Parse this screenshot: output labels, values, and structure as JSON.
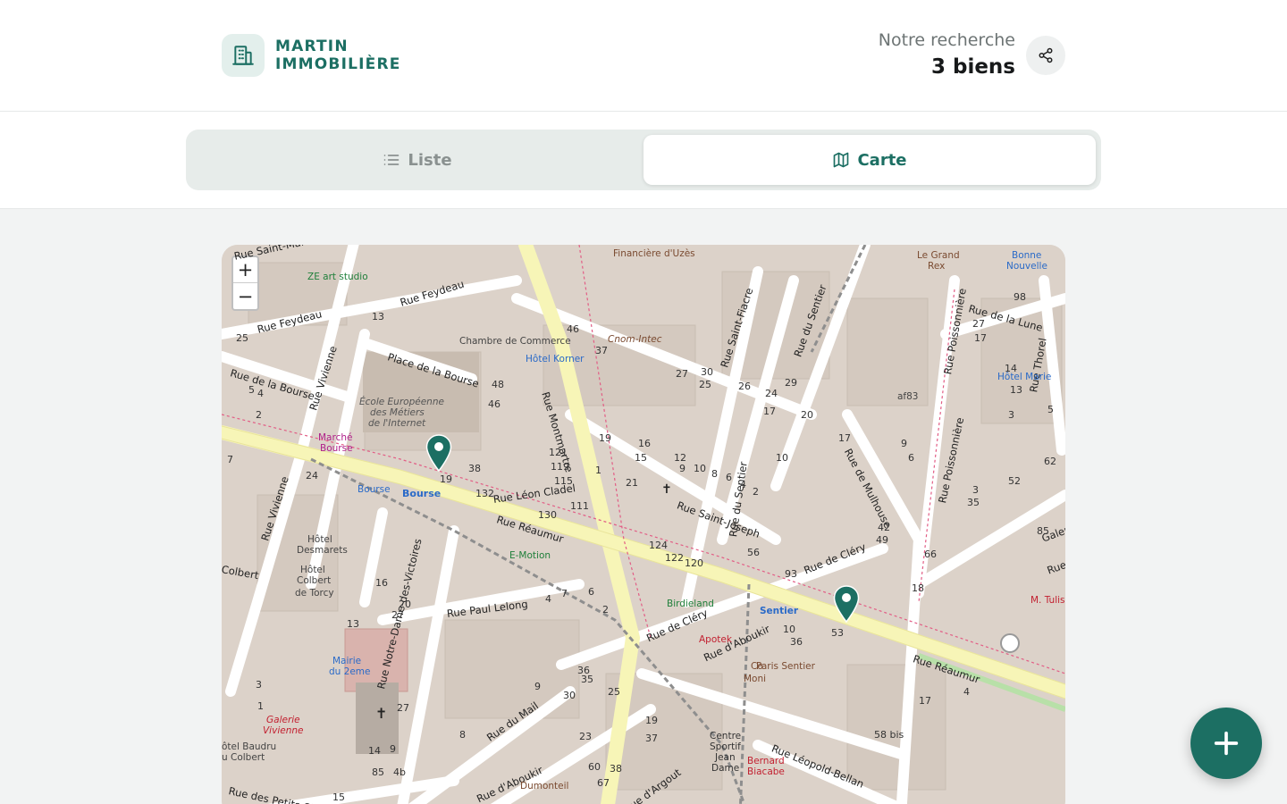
{
  "brand": {
    "line1": "MARTIN",
    "line2": "IMMOBILIÈRE",
    "accent": "#1c6f63"
  },
  "search": {
    "label": "Notre recherche",
    "count": "3 biens"
  },
  "tabs": [
    {
      "label": "Liste",
      "icon": "list-icon",
      "active": false
    },
    {
      "label": "Carte",
      "icon": "map-icon",
      "active": true
    }
  ],
  "map": {
    "zoom_in": "+",
    "zoom_out": "−",
    "streets": {
      "saint_marc": "Rue Saint-Marc",
      "feydeau_1": "Rue Feydeau",
      "feydeau_2": "Rue Feydeau",
      "bourse_1": "Rue de la Bourse",
      "bourse_place": "Place de la Bourse",
      "vivienne_1": "Rue Vivienne",
      "vivienne_2": "Rue Vivienne",
      "montmartre": "Rue Montmartre",
      "reaumur_1": "Rue Réaumur",
      "reaumur_2": "Rue Réaumur",
      "leon_cladel": "Rue Léon Cladel",
      "saint_joseph": "Rue Saint-Joseph",
      "sentier_1": "Rue du Sentier",
      "sentier_2": "Rue du Sentier",
      "saint_fiacre": "Rue Saint-Fiacre",
      "mulhouse": "Rue de Mulhouse",
      "poissonniere_1": "Rue Poissonnière",
      "poissonniere_2": "Rue Poissonnière",
      "lune": "Rue de la Lune",
      "thorel": "Rue Thorel",
      "clery_1": "Rue de Cléry",
      "clery_2": "Rue de Cléry",
      "paul_lelong": "Rue Paul Lelong",
      "notre_dame": "Rue Notre-Dame-des-Victoires",
      "du_mail": "Rue du Mail",
      "aboukir_1": "Rue d'Aboukir",
      "aboukir_2": "Rue d'Aboukir",
      "leopold_bellan": "Rue Léopold-Bellan",
      "argout": "Rue d'Argout",
      "colbert": "Colbert",
      "petits_champs": "Rue des Petits Cha",
      "galerie": "Galer",
      "rue": "Rue"
    },
    "places": {
      "financiere": "Financière d'Uzès",
      "cnom": "Cnom-Intec",
      "chambre": "Chambre de Commerce",
      "hotel_korner": "Hôtel Korner",
      "ecole_1": "École Européenne",
      "ecole_2": "des Métiers",
      "ecole_3": "de l'Internet",
      "marche_1": "Marché",
      "marche_2": "Bourse",
      "ze_art": "ZE art studio",
      "bourse_metro": "Bourse",
      "bourse_stop": "Bourse",
      "hotel_desmarets_1": "Hôtel",
      "hotel_desmarets_2": "Desmarets",
      "hotel_colbert_1": "Hôtel",
      "hotel_colbert_2": "Colbert",
      "hotel_colbert_3": "de Torcy",
      "mairie_1": "Mairie",
      "mairie_2": "du 2eme",
      "galerie_1": "Galerie",
      "galerie_2": "Vivienne",
      "hotel_baudru_1": "ôtel Baudru",
      "hotel_baudru_2": "u Colbert",
      "emotion": "E-Motion",
      "birdieland": "Birdieland",
      "sentier_metro": "Sentier",
      "apotek": "Apotek",
      "paris_sentier": "Paris Sentier",
      "colmon_1": "Co",
      "colmon_2": "Moni",
      "centre_1": "Centre",
      "centre_2": "Sportif",
      "centre_3": "Jean",
      "centre_4": "Dame",
      "bernard_1": "Bernard",
      "bernard_2": "Biacabe",
      "dumonteil": "Dumonteil",
      "grand_rex_1": "Le Grand",
      "grand_rex_2": "Rex",
      "bonne_1": "Bonne",
      "bonne_2": "Nouvelle",
      "hotel_marie": "Hôtel Marie",
      "af83": "af83",
      "m_tulis": "M. Tulis"
    },
    "house_numbers": [
      "13",
      "25",
      "4",
      "5",
      "2",
      "7",
      "24",
      "19",
      "16",
      "3",
      "1",
      "20",
      "27",
      "13",
      "38",
      "48",
      "46",
      "132",
      "130",
      "121",
      "119",
      "115",
      "111",
      "124",
      "122",
      "120",
      "37",
      "46",
      "27",
      "30",
      "25",
      "26",
      "24",
      "17",
      "20",
      "29",
      "10",
      "19",
      "16",
      "15",
      "12",
      "9",
      "10",
      "8",
      "6",
      "4",
      "2",
      "1",
      "21",
      "17",
      "9",
      "6",
      "3",
      "35",
      "52",
      "62",
      "49",
      "66",
      "42",
      "85",
      "27",
      "98",
      "17",
      "14",
      "13",
      "5",
      "3",
      "18",
      "10",
      "36",
      "53",
      "56",
      "93",
      "4",
      "17",
      "85",
      "14",
      "9",
      "7",
      "6",
      "4",
      "2",
      "36",
      "35",
      "30",
      "23",
      "25",
      "19",
      "37",
      "38",
      "67",
      "60",
      "58 bis",
      "15",
      "27",
      "4b",
      "8",
      "9",
      "10",
      "12"
    ],
    "markers": [
      {
        "name": "property-marker-1"
      },
      {
        "name": "property-marker-2"
      }
    ]
  },
  "fab": {
    "icon": "plus-icon"
  }
}
